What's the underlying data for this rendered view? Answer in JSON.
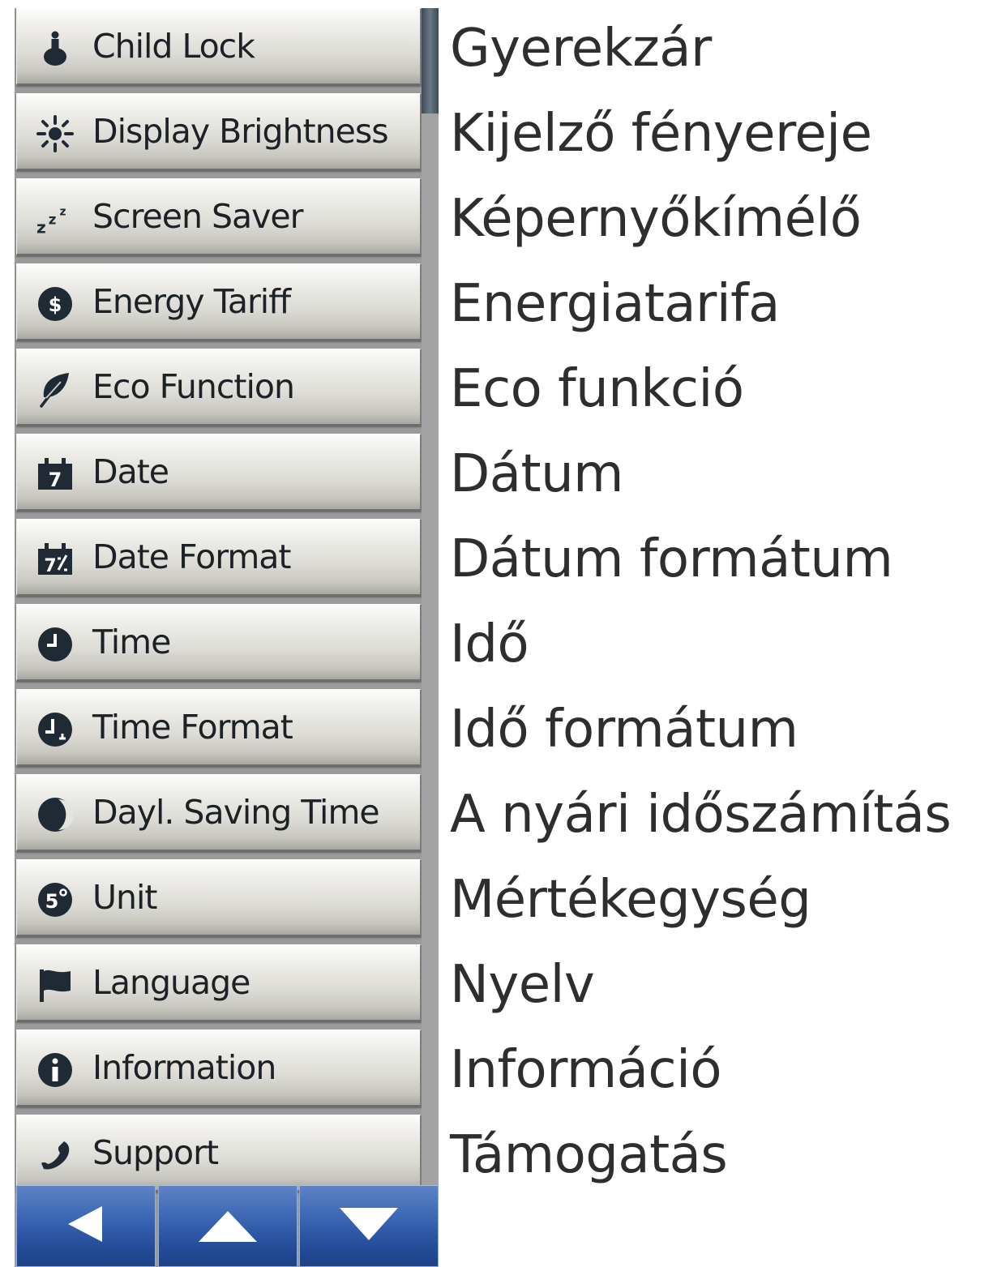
{
  "menu": {
    "items": [
      {
        "label": "Child Lock",
        "icon": "child-lock-icon"
      },
      {
        "label": "Display Brightness",
        "icon": "brightness-icon"
      },
      {
        "label": "Screen Saver",
        "icon": "sleep-zzz-icon"
      },
      {
        "label": "Energy Tariff",
        "icon": "dollar-coin-icon"
      },
      {
        "label": "Eco Function",
        "icon": "leaf-icon"
      },
      {
        "label": "Date",
        "icon": "calendar-icon"
      },
      {
        "label": "Date Format",
        "icon": "calendar-format-icon"
      },
      {
        "label": "Time",
        "icon": "clock-icon"
      },
      {
        "label": "Time Format",
        "icon": "clock-format-icon"
      },
      {
        "label": "Dayl. Saving Time",
        "icon": "half-moon-icon"
      },
      {
        "label": "Unit",
        "icon": "degree-unit-icon"
      },
      {
        "label": "Language",
        "icon": "flag-icon"
      },
      {
        "label": "Information",
        "icon": "info-icon"
      },
      {
        "label": "Support",
        "icon": "phone-handset-icon"
      }
    ]
  },
  "scroll_position": 0,
  "nav": {
    "back_icon": "arrow-left-icon",
    "up_icon": "arrow-up-icon",
    "down_icon": "arrow-down-icon"
  },
  "translations": [
    "Gyerekzár",
    "Kijelző fényereje",
    "Képernyőkímélő",
    "Energiatarifa",
    "Eco funkció",
    "Dátum",
    "Dátum formátum",
    "Idő",
    "Idő formátum",
    "A nyári időszámítás",
    "Mértékegység",
    "Nyelv",
    "Információ",
    "Támogatás"
  ],
  "colors": {
    "icon": "#1f2a35",
    "nav_button": "#2f5aa8",
    "text": "#2e2e2e"
  }
}
